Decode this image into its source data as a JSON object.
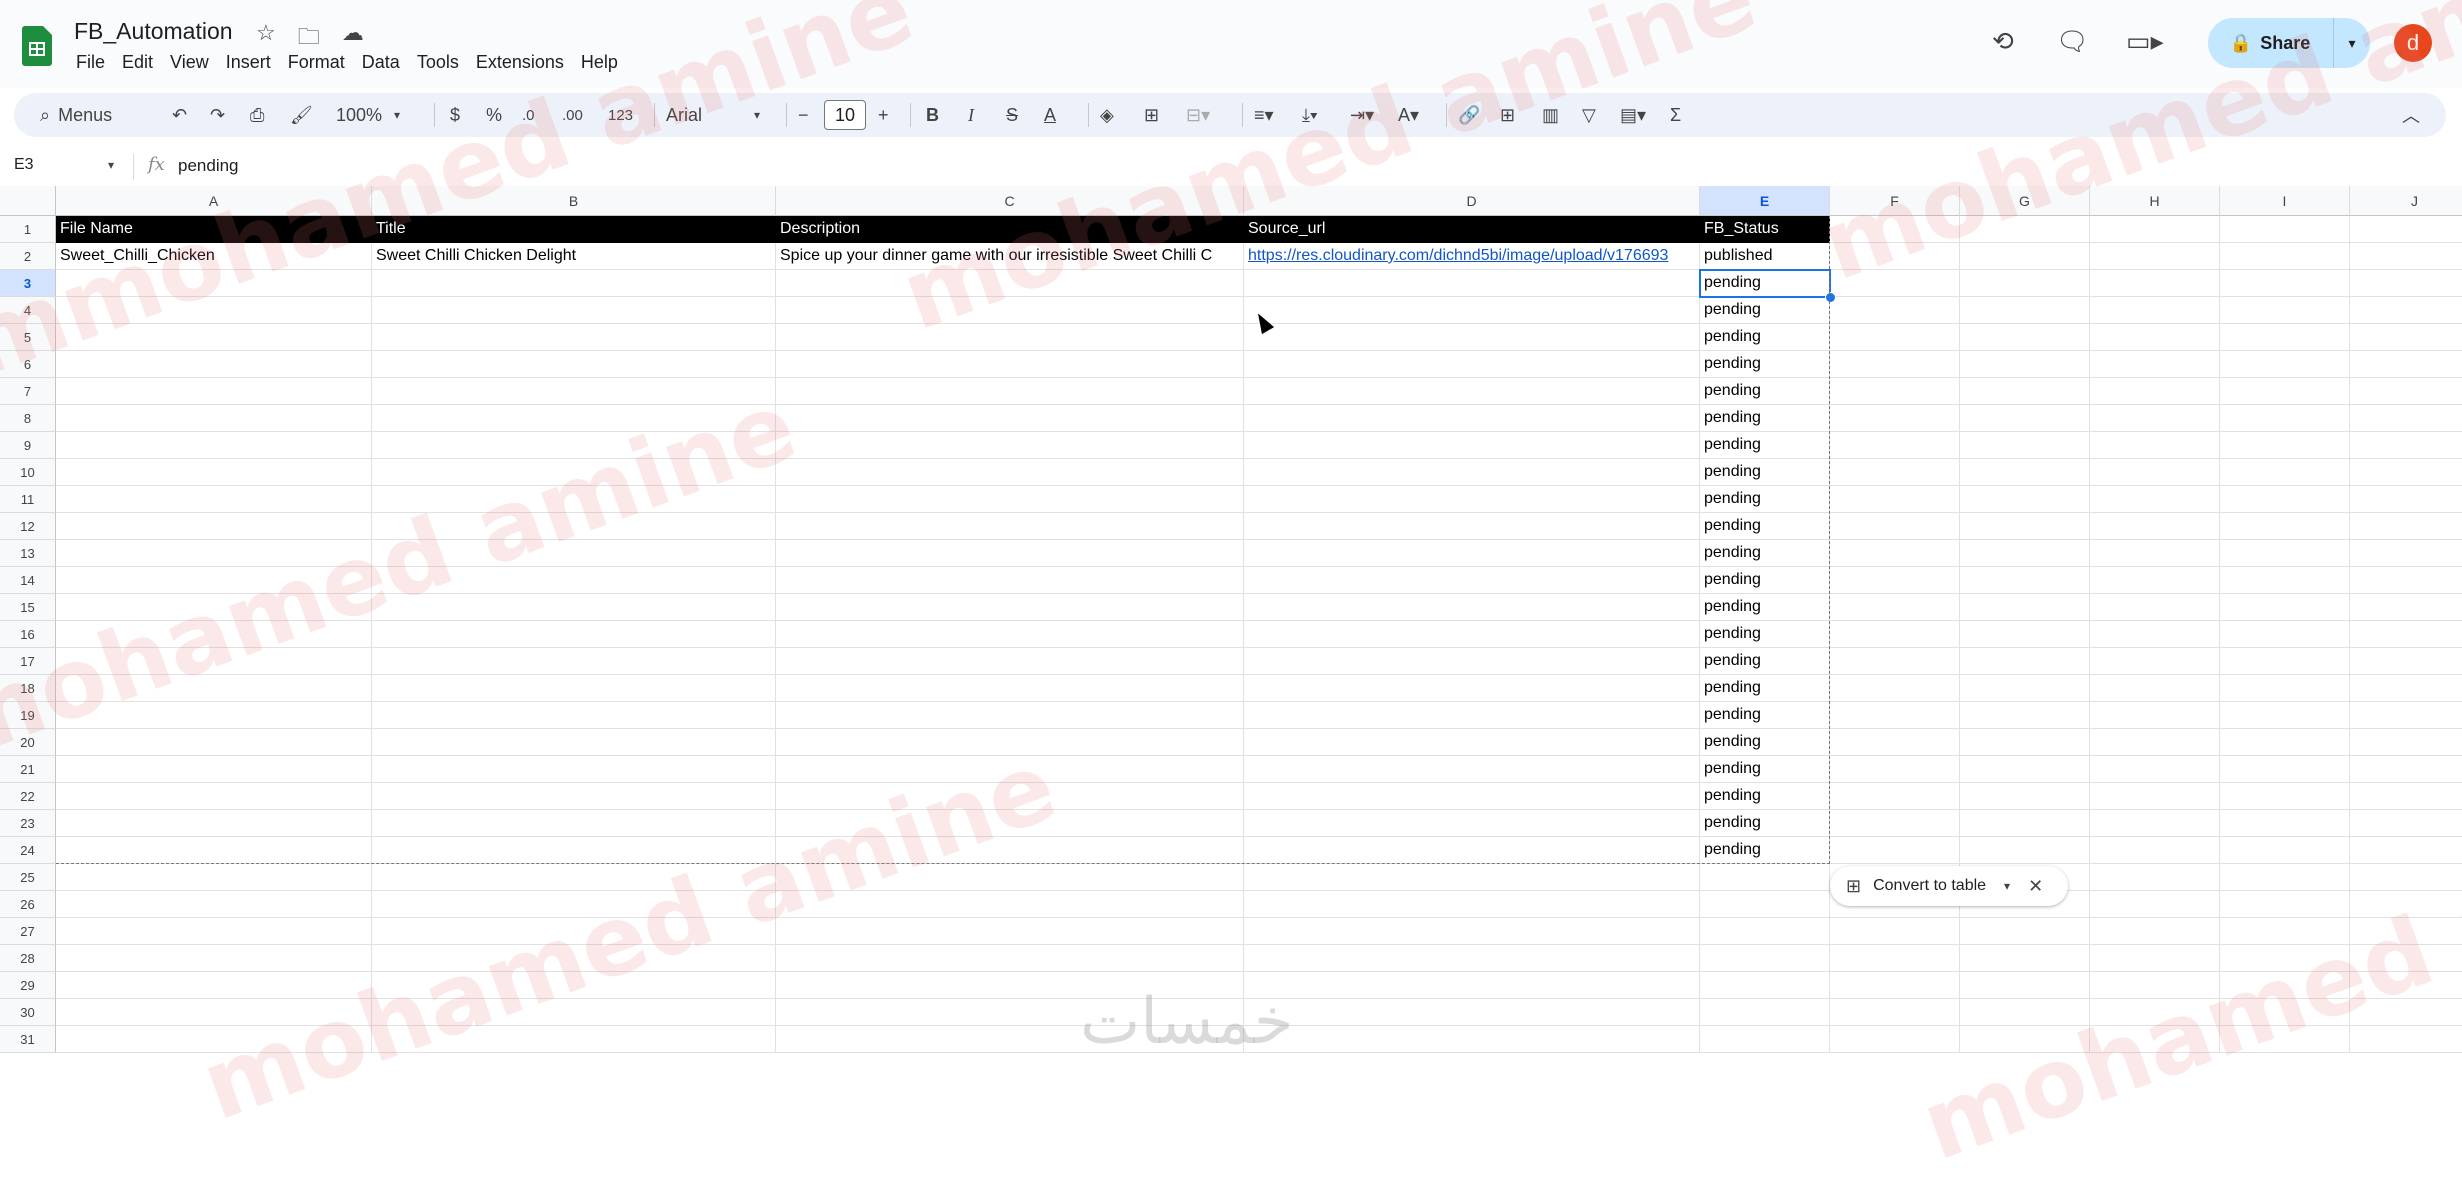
{
  "app": {
    "title": "FB_Automation",
    "menus": [
      "File",
      "Edit",
      "View",
      "Insert",
      "Format",
      "Data",
      "Tools",
      "Extensions",
      "Help"
    ],
    "share_label": "Share",
    "avatar_letter": "d"
  },
  "toolbar": {
    "menus_label": "Menus",
    "zoom": "100%",
    "currency": "$",
    "percent": "%",
    "dec_less": ".0",
    "dec_more": ".00",
    "format_123": "123",
    "font": "Arial",
    "font_size": "10",
    "bold": "B",
    "italic": "I",
    "strike": "S",
    "text_color": "A",
    "sum": "Σ"
  },
  "formula_bar": {
    "cell_ref": "E3",
    "fx": "fx",
    "value": "pending"
  },
  "columns": [
    "A",
    "B",
    "C",
    "D",
    "E",
    "F",
    "G",
    "H",
    "I",
    "J"
  ],
  "header_row": [
    "File Name",
    "Title",
    "Description",
    "Source_url",
    "FB_Status"
  ],
  "row2": [
    "Sweet_Chilli_Chicken",
    "Sweet Chilli Chicken Delight",
    "Spice up your dinner game with our irresistible Sweet Chilli C",
    "https://res.cloudinary.com/dichnd5bi/image/upload/v176693",
    "published"
  ],
  "status_pending": "pending",
  "convert_chip": "Convert to table",
  "watermark_text": "mohamed amine",
  "bottom_logo": "خمسات"
}
